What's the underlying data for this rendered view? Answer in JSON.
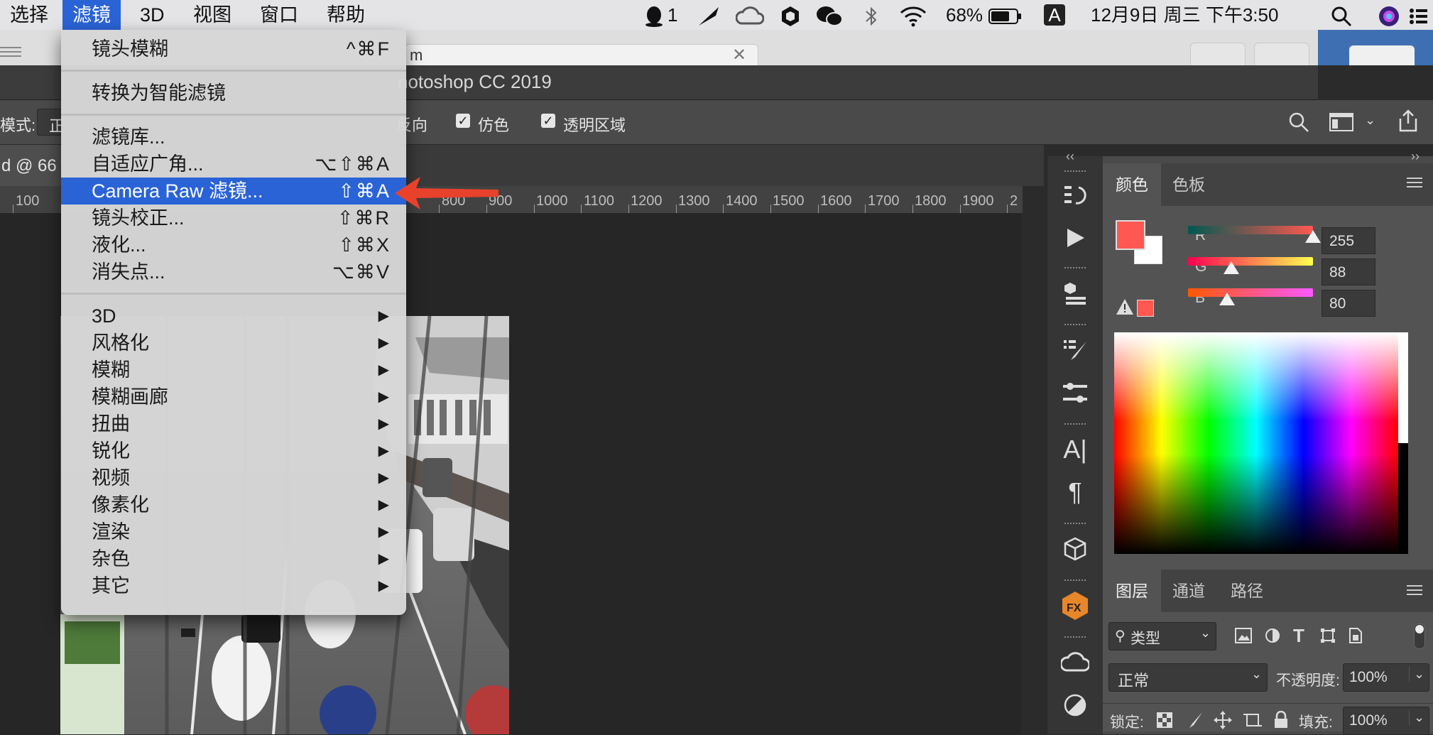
{
  "menubar": {
    "items": [
      "选择",
      "滤镜",
      "3D",
      "视图",
      "窗口",
      "帮助"
    ],
    "active_index": 1,
    "status": {
      "qq_count": "1",
      "battery": "68%",
      "input_method": "A",
      "datetime": "12月9日 周三 下午3:50"
    }
  },
  "browser_tab": {
    "text_fragment": "m"
  },
  "photoshop": {
    "title_fragment": "notoshop CC 2019",
    "options": {
      "mode_label": "模式:",
      "mode_value_fragment": "正",
      "reverse_label_fragment": "反向",
      "dither_label": "仿色",
      "transparency_label": "透明区域"
    },
    "doc_tab_fragment": "d @ 66",
    "ruler": [
      "100",
      "800",
      "900",
      "1000",
      "1100",
      "1200",
      "1300",
      "1400",
      "1500",
      "1600",
      "1700",
      "1800",
      "1900",
      "2"
    ]
  },
  "filter_menu": {
    "items": [
      {
        "label": "镜头模糊",
        "shortcut": "^⌘F"
      },
      {
        "sep": true
      },
      {
        "label": "转换为智能滤镜",
        "shortcut": ""
      },
      {
        "sep": true
      },
      {
        "label": "滤镜库...",
        "shortcut": ""
      },
      {
        "label": "自适应广角...",
        "shortcut": "⌥⇧⌘A"
      },
      {
        "label": "Camera Raw 滤镜...",
        "shortcut": "⇧⌘A",
        "highlighted": true
      },
      {
        "label": "镜头校正...",
        "shortcut": "⇧⌘R"
      },
      {
        "label": "液化...",
        "shortcut": "⇧⌘X"
      },
      {
        "label": "消失点...",
        "shortcut": "⌥⌘V"
      },
      {
        "sep": true
      },
      {
        "label": "3D",
        "submenu": true
      },
      {
        "label": "风格化",
        "submenu": true
      },
      {
        "label": "模糊",
        "submenu": true
      },
      {
        "label": "模糊画廊",
        "submenu": true
      },
      {
        "label": "扭曲",
        "submenu": true
      },
      {
        "label": "锐化",
        "submenu": true
      },
      {
        "label": "视频",
        "submenu": true
      },
      {
        "label": "像素化",
        "submenu": true
      },
      {
        "label": "渲染",
        "submenu": true
      },
      {
        "label": "杂色",
        "submenu": true
      },
      {
        "label": "其它",
        "submenu": true
      }
    ]
  },
  "color_panel": {
    "tabs": [
      "颜色",
      "色板"
    ],
    "channels": [
      {
        "name": "R",
        "value": "255",
        "level": 1.0
      },
      {
        "name": "G",
        "value": "88",
        "level": 0.345
      },
      {
        "name": "B",
        "value": "80",
        "level": 0.314
      }
    ],
    "foreground": "#ff5850",
    "background": "#ffffff"
  },
  "layers_panel": {
    "tabs": [
      "图层",
      "通道",
      "路径"
    ],
    "filter_label": "类型",
    "blend_mode": "正常",
    "opacity_label": "不透明度:",
    "opacity_value": "100%",
    "lock_label": "锁定:",
    "fill_label": "填充:",
    "fill_value": "100%"
  },
  "colors": {
    "menu_highlight": "#2a63d6",
    "arrow": "#e8412c"
  }
}
